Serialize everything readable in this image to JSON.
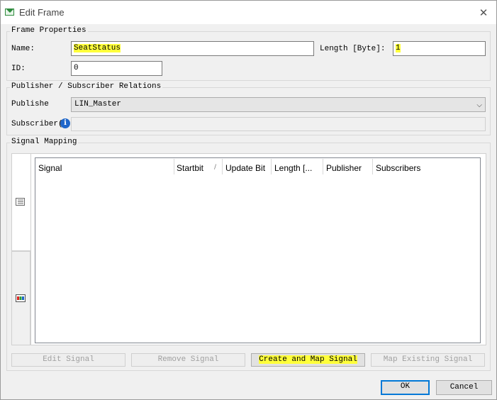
{
  "window": {
    "title": "Edit Frame",
    "close_glyph": "✕",
    "icon": "frame-icon"
  },
  "frame_properties": {
    "group_title": "Frame Properties",
    "name_label": "Name:",
    "name_value": "SeatStatus",
    "length_label": "Length [Byte]:",
    "length_value": "1",
    "id_label": "ID:",
    "id_value": "0"
  },
  "relations": {
    "group_title": "Publisher / Subscriber Relations",
    "publisher_label": "Publishe",
    "publisher_value": "LIN_Master",
    "subscriber_label": "Subscriber(",
    "info_glyph": "i",
    "dropdown_glyph": "⌵"
  },
  "signal_mapping": {
    "group_title": "Signal Mapping",
    "columns": [
      "Signal",
      "Startbit",
      "Update Bit",
      "Length [...",
      "Publisher",
      "Subscribers"
    ],
    "sort_glyph": "/",
    "buttons": {
      "edit": "Edit Signal",
      "remove": "Remove Signal",
      "create": "Create and Map Signal",
      "map_existing": "Map Existing Signal"
    }
  },
  "footer": {
    "ok": "OK",
    "cancel": "Cancel"
  },
  "colors": {
    "highlight": "#ffff3a",
    "primary_border": "#0078d7"
  }
}
